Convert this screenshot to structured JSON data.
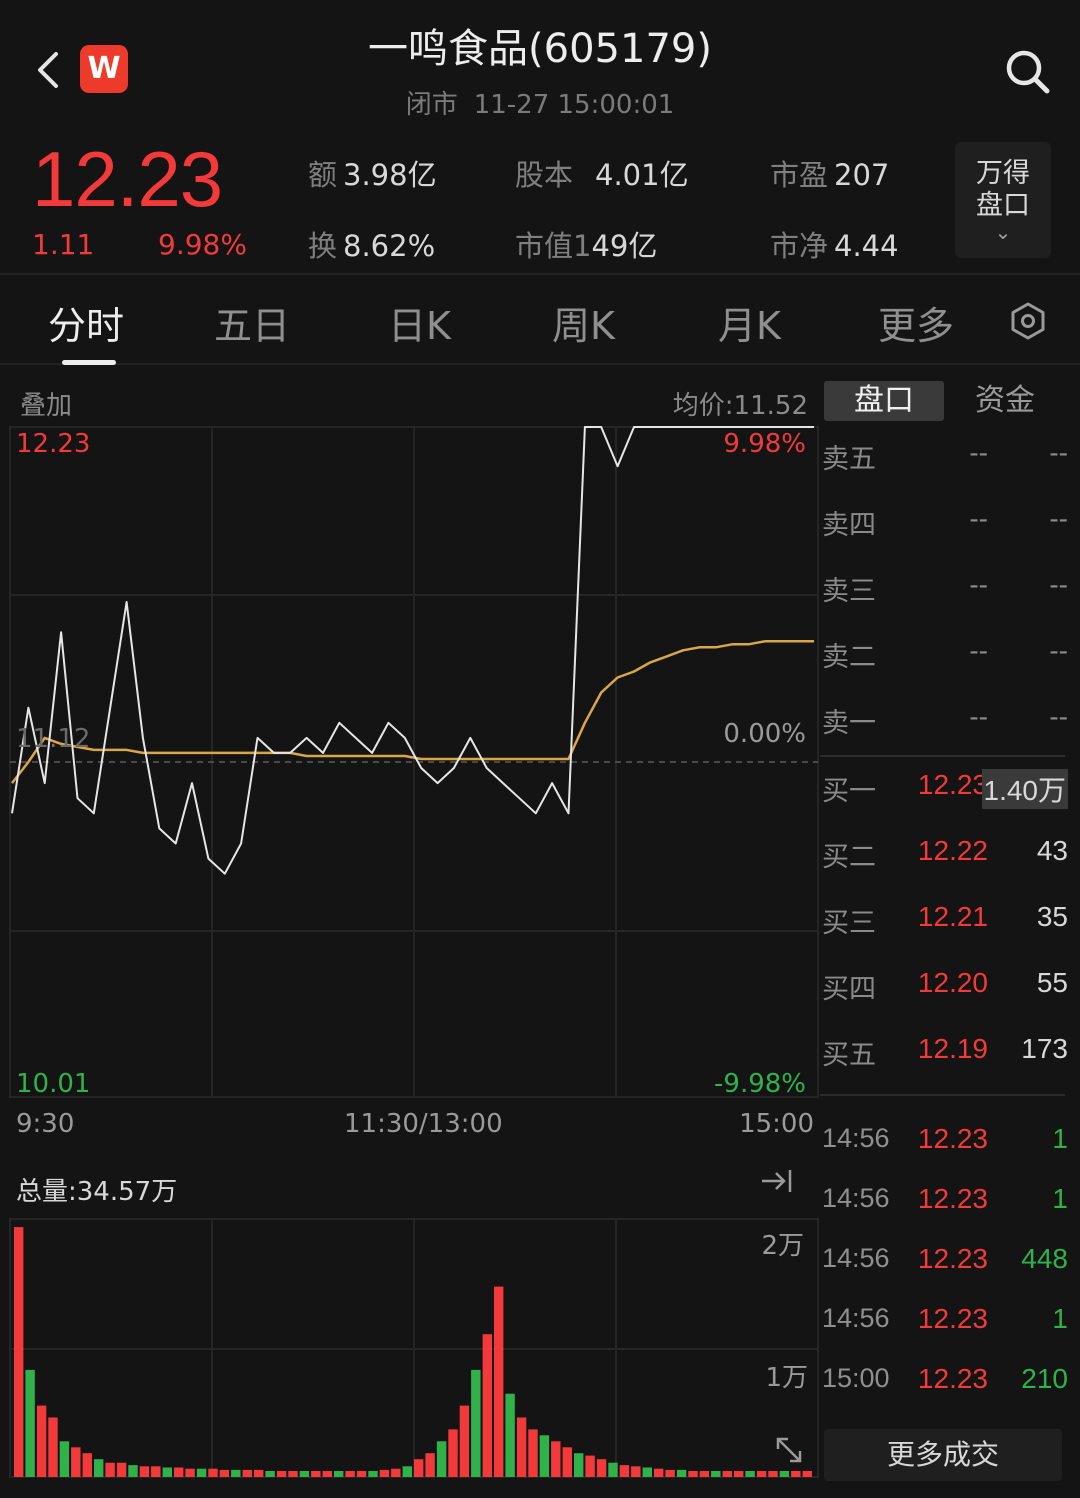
{
  "header": {
    "title": "一鸣食品(605179)",
    "status": "闭市",
    "datetime": "11-27 15:00:01",
    "logo_letter": "W",
    "back_icon": "chevron-left-icon",
    "search_icon": "search-icon"
  },
  "quote": {
    "price": "12.23",
    "change": "1.11",
    "change_pct": "9.98%",
    "stats": [
      {
        "k": "额",
        "v": "3.98亿"
      },
      {
        "k": "股本",
        "v": "4.01亿"
      },
      {
        "k": "市盈",
        "v": "207"
      },
      {
        "k": "换",
        "v": "8.62%"
      },
      {
        "k": "市值1",
        "v": "49亿"
      },
      {
        "k": "市净",
        "v": "4.44"
      }
    ],
    "wd_button": [
      "万得",
      "盘口"
    ],
    "wd_chevron": "⌄"
  },
  "tabs": [
    "分时",
    "五日",
    "日K",
    "周K",
    "月K",
    "更多"
  ],
  "chart": {
    "overlay_label": "叠加",
    "avg_price_label": "均价:11.52",
    "y_top": "12.23",
    "y_mid": "11.12",
    "y_bottom": "10.01",
    "pct_top": "9.98%",
    "pct_mid": "0.00%",
    "pct_bottom": "-9.98%",
    "times": [
      "9:30",
      "11:30/13:00",
      "15:00"
    ],
    "volume_total": "总量:34.57万",
    "vol_2w": "2万",
    "vol_1w": "1万"
  },
  "colors": {
    "up": "#f23a3a",
    "down": "#2fb24a",
    "price_line": "#e6e6e6",
    "avg_line": "#d9a74a",
    "background": "#141414"
  },
  "panel": {
    "tab_active": "盘口",
    "tab_other": "资金",
    "asks": [
      {
        "n": "卖五",
        "p": "--",
        "v": "--"
      },
      {
        "n": "卖四",
        "p": "--",
        "v": "--"
      },
      {
        "n": "卖三",
        "p": "--",
        "v": "--"
      },
      {
        "n": "卖二",
        "p": "--",
        "v": "--"
      },
      {
        "n": "卖一",
        "p": "--",
        "v": "--"
      }
    ],
    "bids": [
      {
        "n": "买一",
        "p": "12.23",
        "v": "1.40万"
      },
      {
        "n": "买二",
        "p": "12.22",
        "v": "43"
      },
      {
        "n": "买三",
        "p": "12.21",
        "v": "35"
      },
      {
        "n": "买四",
        "p": "12.20",
        "v": "55"
      },
      {
        "n": "买五",
        "p": "12.19",
        "v": "173"
      }
    ],
    "ticks": [
      {
        "t": "14:56",
        "p": "12.23",
        "v": "1",
        "c": "#2fb24a"
      },
      {
        "t": "14:56",
        "p": "12.23",
        "v": "1",
        "c": "#2fb24a"
      },
      {
        "t": "14:56",
        "p": "12.23",
        "v": "448",
        "c": "#2fb24a"
      },
      {
        "t": "14:56",
        "p": "12.23",
        "v": "1",
        "c": "#2fb24a"
      },
      {
        "t": "15:00",
        "p": "12.23",
        "v": "210",
        "c": "#2fb24a"
      }
    ],
    "more_label": "更多成交"
  },
  "chart_data": {
    "type": "line",
    "x_range": [
      "9:30",
      "15:00"
    ],
    "y_range": [
      10.01,
      12.23
    ],
    "prev_close": 11.12,
    "series": [
      {
        "values": [
          10.95,
          11.3,
          11.05,
          11.55,
          11.0,
          10.95,
          11.3,
          11.65,
          11.2,
          10.9,
          10.85,
          11.05,
          10.8,
          10.75,
          10.85,
          11.2,
          11.15,
          11.15,
          11.2,
          11.15,
          11.25,
          11.2,
          11.15,
          11.25,
          11.2,
          11.1,
          11.05,
          11.1,
          11.2,
          11.1,
          11.05,
          11.0,
          10.95,
          11.05,
          10.95,
          12.23,
          12.23,
          12.1,
          12.23,
          12.23,
          12.23,
          12.23,
          12.23,
          12.23,
          12.23,
          12.23,
          12.23,
          12.23,
          12.23,
          12.23
        ]
      },
      {
        "values": [
          11.05,
          11.12,
          11.2,
          11.18,
          11.17,
          11.16,
          11.16,
          11.16,
          11.15,
          11.15,
          11.15,
          11.15,
          11.15,
          11.15,
          11.15,
          11.15,
          11.15,
          11.15,
          11.14,
          11.14,
          11.14,
          11.14,
          11.14,
          11.14,
          11.14,
          11.13,
          11.13,
          11.13,
          11.13,
          11.13,
          11.13,
          11.13,
          11.13,
          11.13,
          11.13,
          11.25,
          11.35,
          11.4,
          11.42,
          11.45,
          11.47,
          11.49,
          11.5,
          11.5,
          11.51,
          11.51,
          11.52,
          11.52,
          11.52,
          11.52
        ]
      }
    ],
    "volume": [
      21000,
      9000,
      6000,
      5000,
      3000,
      2500,
      2000,
      1500,
      1200,
      1200,
      1000,
      900,
      900,
      800,
      800,
      700,
      700,
      700,
      600,
      600,
      600,
      600,
      500,
      500,
      500,
      500,
      500,
      500,
      500,
      500,
      500,
      500,
      600,
      700,
      900,
      1500,
      2000,
      3000,
      4000,
      6000,
      9000,
      12000,
      16000,
      7000,
      5000,
      4000,
      3500,
      3000,
      2500,
      2000,
      1800,
      1500,
      1200,
      1000,
      900,
      800,
      700,
      600,
      600,
      500,
      500,
      500,
      500,
      500,
      500,
      500,
      500,
      500,
      500,
      500
    ]
  }
}
